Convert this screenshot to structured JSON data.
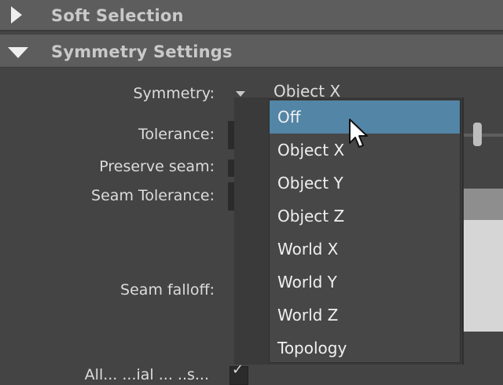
{
  "sections": {
    "soft_selection": {
      "title": "Soft Selection",
      "expanded": false
    },
    "symmetry_settings": {
      "title": "Symmetry Settings",
      "expanded": true
    }
  },
  "fields": {
    "symmetry_label": "Symmetry:",
    "symmetry_value": "Object X",
    "tolerance_label": "Tolerance:",
    "preserve_seam_label": "Preserve seam:",
    "seam_tolerance_label": "Seam Tolerance:",
    "seam_falloff_label": "Seam falloff:",
    "allow_partial_label": "All... ...ial ... ..s..."
  },
  "dropdown": {
    "selected": "Off",
    "options": [
      "Off",
      "Object X",
      "Object Y",
      "Object Z",
      "World X",
      "World Y",
      "World Z",
      "Topology"
    ]
  },
  "colors": {
    "panel_background": "#444444",
    "header_background": "#5d5d5d",
    "selection_highlight": "#5285a6"
  },
  "icons": {
    "collapsed_arrow": "triangle-right-icon",
    "expanded_arrow": "triangle-down-icon",
    "combo_arrow": "chevron-down-icon",
    "pointer": "mouse-pointer-icon"
  }
}
